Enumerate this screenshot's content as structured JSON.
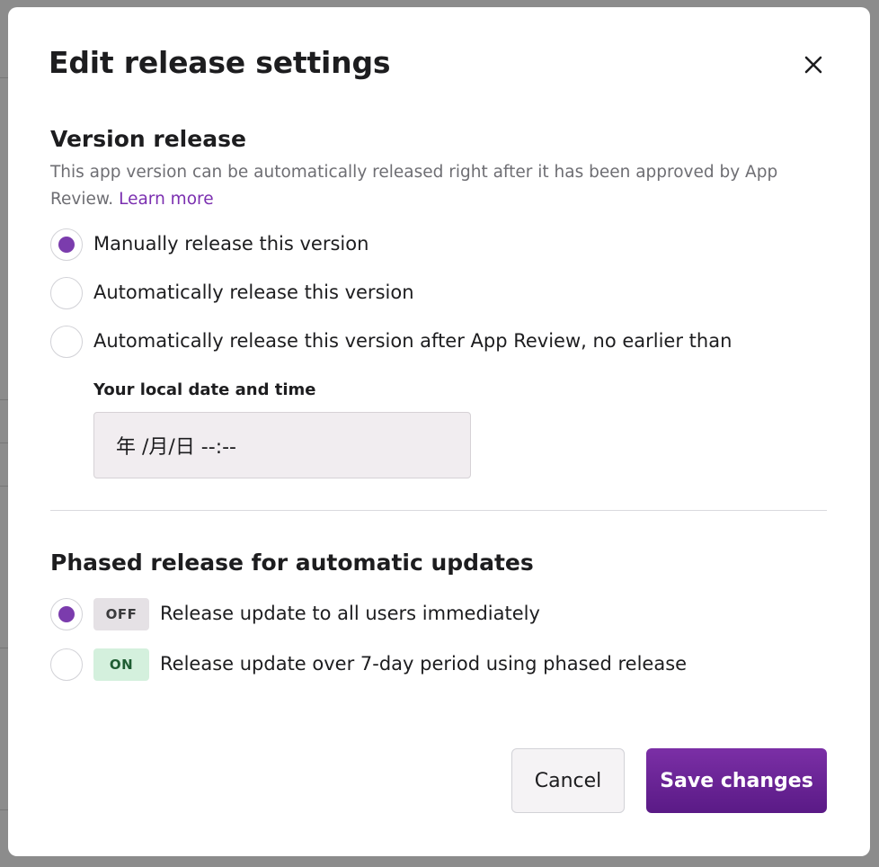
{
  "dialog": {
    "title": "Edit release settings",
    "close_icon": "close-icon"
  },
  "version_release": {
    "title": "Version release",
    "description": "This app version can be automatically released right after it has been approved by App Review.",
    "learn_more": "Learn more",
    "options": [
      {
        "label": "Manually release this version",
        "selected": true
      },
      {
        "label": "Automatically release this version",
        "selected": false
      },
      {
        "label": "Automatically release this version after App Review, no earlier than",
        "selected": false
      }
    ],
    "date_field": {
      "label": "Your local date and time",
      "value": "年 /月/日 --:--"
    }
  },
  "phased_release": {
    "title": "Phased release for automatic updates",
    "options": [
      {
        "badge": "OFF",
        "label": "Release update to all users immediately",
        "selected": true
      },
      {
        "badge": "ON",
        "label": "Release update over 7-day period using phased release",
        "selected": false
      }
    ]
  },
  "actions": {
    "cancel": "Cancel",
    "save": "Save changes"
  },
  "colors": {
    "accent": "#7b3cad",
    "link": "#7b2fb0",
    "save_button": "#6a2496",
    "badge_on_bg": "#d4f0dd",
    "badge_off_bg": "#e5e1e5"
  }
}
